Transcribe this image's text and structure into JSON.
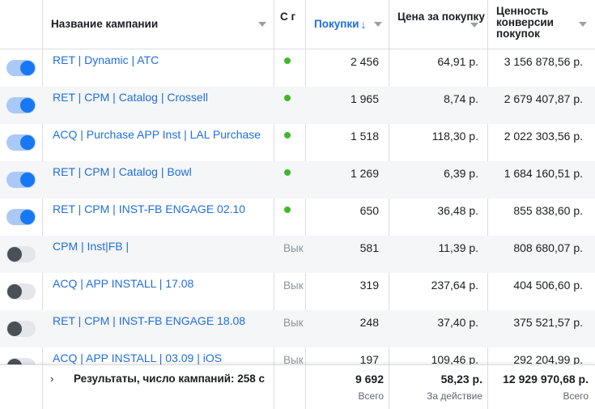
{
  "header": {
    "name": "Название кампании",
    "delivery": "С г",
    "purchases": "Покупки",
    "purchases_arrow": "↓",
    "price": "Цена за покупку",
    "value": "Ценность конверсии покупок"
  },
  "rows": [
    {
      "name": "RET | Dynamic | ATC",
      "on": true,
      "status": "",
      "purchases": "2 456",
      "price": "64,91 р.",
      "value": "3 156 878,56 р."
    },
    {
      "name": "RET | CPM | Catalog | Crossell",
      "on": true,
      "status": "",
      "purchases": "1 965",
      "price": "8,74 р.",
      "value": "2 679 407,87 р."
    },
    {
      "name": "ACQ | Purchase APP Inst | LAL Purchase",
      "on": true,
      "status": "",
      "purchases": "1 518",
      "price": "118,30 р.",
      "value": "2 022 303,56 р."
    },
    {
      "name": "RET | CPM | Catalog | Bowl",
      "on": true,
      "status": "",
      "purchases": "1 269",
      "price": "6,39 р.",
      "value": "1 684 160,51 р."
    },
    {
      "name": "RET | CPM | INST-FB ENGAGE 02.10",
      "on": true,
      "status": "",
      "purchases": "650",
      "price": "36,48 р.",
      "value": "855 838,60 р."
    },
    {
      "name": "CPM | Inst|FB |",
      "on": false,
      "status": "Вык",
      "purchases": "581",
      "price": "11,39 р.",
      "value": "808 680,07 р."
    },
    {
      "name": "ACQ | APP INSTALL | 17.08",
      "on": false,
      "status": "Вык",
      "purchases": "319",
      "price": "237,64 р.",
      "value": "404 506,60 р."
    },
    {
      "name": "RET | CPM | INST-FB ENGAGE 18.08",
      "on": false,
      "status": "Вык",
      "purchases": "248",
      "price": "37,40 р.",
      "value": "375 521,57 р."
    },
    {
      "name": "ACQ | APP INSTALL | 03.09 | iOS",
      "on": false,
      "status": "Вык",
      "purchases": "197",
      "price": "109,46 р.",
      "value": "292 204,99 р."
    }
  ],
  "footer": {
    "chevron": "›",
    "title": "Результаты, число кампаний: 258 с",
    "purchases_total": "9 692",
    "purchases_sub": "Всего",
    "price_total": "58,23 р.",
    "price_sub": "За действие",
    "value_total": "12 929 970,68 р.",
    "value_sub": "Всего"
  },
  "colors": {
    "link": "#216fdb",
    "toggle_on_knob": "#1877f2",
    "toggle_on_track": "#aac9f7",
    "active_dot": "#42b72a"
  },
  "icons": {
    "sort": "caret-down-icon",
    "active": "status-dot-icon",
    "expand": "chevron-right-icon"
  }
}
